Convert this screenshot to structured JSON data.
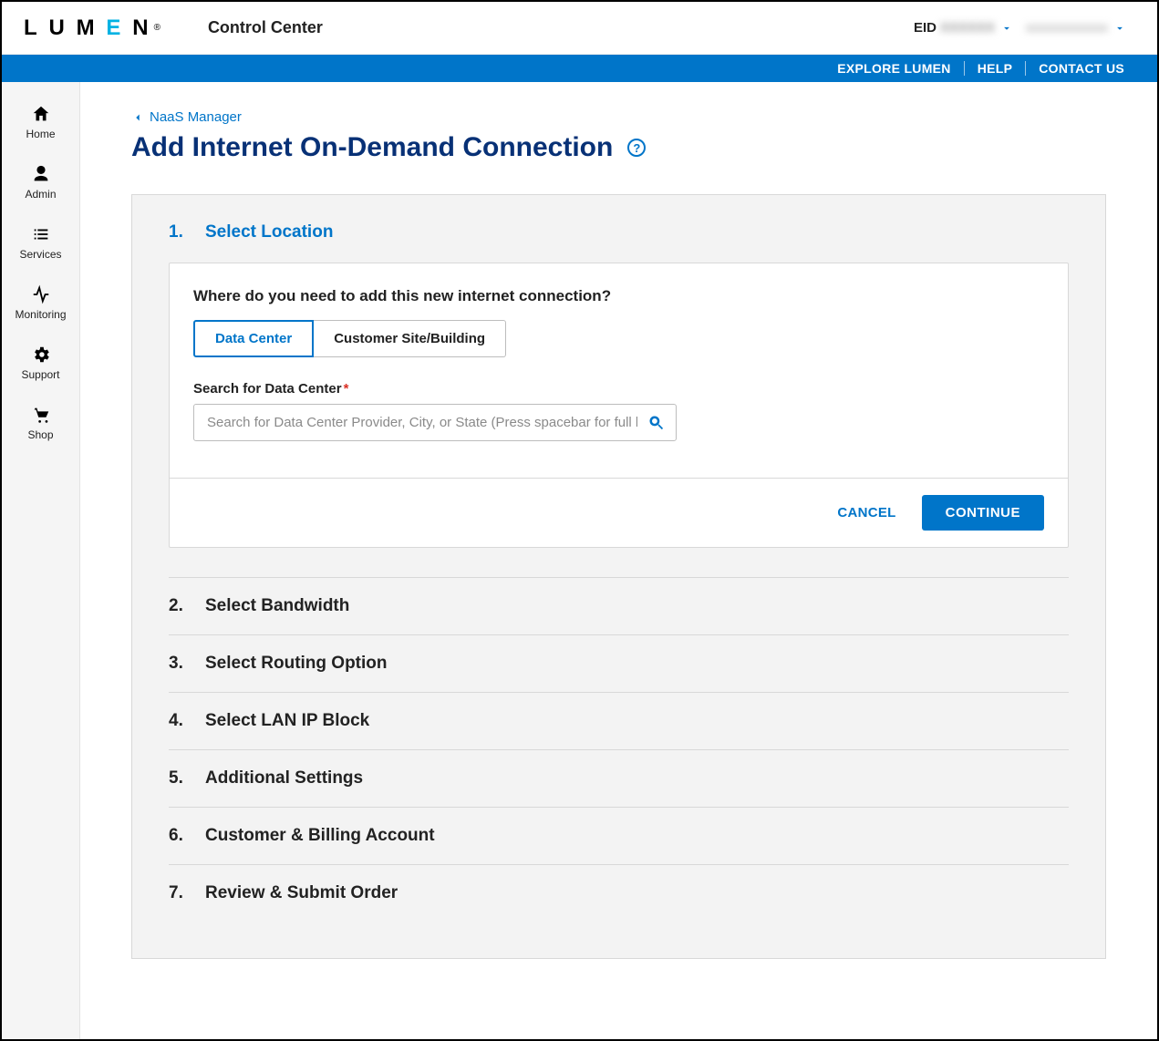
{
  "header": {
    "brand": "LUMEN",
    "product": "Control Center",
    "eid_label": "EID",
    "eid_value": "XXXXXX",
    "account": "xxxxxxxxxxxx"
  },
  "bluebar": {
    "explore": "EXPLORE LUMEN",
    "help": "HELP",
    "contact": "CONTACT US"
  },
  "sidebar": [
    {
      "key": "home",
      "label": "Home"
    },
    {
      "key": "admin",
      "label": "Admin"
    },
    {
      "key": "services",
      "label": "Services"
    },
    {
      "key": "monitoring",
      "label": "Monitoring"
    },
    {
      "key": "support",
      "label": "Support"
    },
    {
      "key": "shop",
      "label": "Shop"
    }
  ],
  "breadcrumb": {
    "back": "NaaS Manager"
  },
  "page_title": "Add Internet On-Demand Connection",
  "steps": [
    {
      "num": "1.",
      "title": "Select Location",
      "active": true
    },
    {
      "num": "2.",
      "title": "Select Bandwidth"
    },
    {
      "num": "3.",
      "title": "Select Routing Option"
    },
    {
      "num": "4.",
      "title": "Select LAN IP Block"
    },
    {
      "num": "5.",
      "title": "Additional Settings"
    },
    {
      "num": "6.",
      "title": "Customer & Billing Account"
    },
    {
      "num": "7.",
      "title": "Review & Submit Order"
    }
  ],
  "step1": {
    "question": "Where do you need to add this new internet connection?",
    "option_data_center": "Data Center",
    "option_customer_site": "Customer Site/Building",
    "search_label": "Search for Data Center",
    "search_placeholder": "Search for Data Center Provider, City, or State (Press spacebar for full list)",
    "cancel": "CANCEL",
    "continue": "CONTINUE"
  }
}
